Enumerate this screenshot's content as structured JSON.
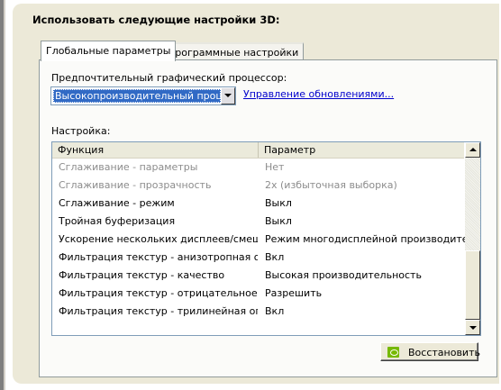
{
  "section_title": "Использовать следующие настройки 3D:",
  "tabs": [
    {
      "label": "Глобальные параметры",
      "active": true
    },
    {
      "label": "Программные настройки",
      "active": false
    }
  ],
  "gpu": {
    "label": "Предпочтительный графический процессор:",
    "selected": "Высокопроизводительный процессо",
    "update_link": "Управление обновлениями..."
  },
  "settings": {
    "label": "Настройка:",
    "columns": [
      "Функция",
      "Параметр"
    ],
    "rows": [
      {
        "feature": "Сглаживание - параметры",
        "value": "Нет",
        "disabled": true
      },
      {
        "feature": "Сглаживание - прозрачность",
        "value": "2x (избыточная выборка)",
        "disabled": true
      },
      {
        "feature": "Сглаживание - режим",
        "value": "Выкл",
        "disabled": false
      },
      {
        "feature": "Тройная буферизация",
        "value": "Выкл",
        "disabled": false
      },
      {
        "feature": "Ускорение нескольких дисплеев/смеша...",
        "value": "Режим многодисплейной производител...",
        "disabled": false
      },
      {
        "feature": "Фильтрация текстур - анизотропная оп...",
        "value": "Вкл",
        "disabled": false
      },
      {
        "feature": "Фильтрация текстур - качество",
        "value": "Высокая производительность",
        "disabled": false
      },
      {
        "feature": "Фильтрация текстур - отрицательное о...",
        "value": "Разрешить",
        "disabled": false
      },
      {
        "feature": "Фильтрация текстур - трилинейная опт...",
        "value": "Вкл",
        "disabled": false
      }
    ]
  },
  "restore_button": {
    "label": "Восстановить",
    "icon": "nvidia-logo-icon"
  },
  "colors": {
    "selection": "#316ac5",
    "link": "#0000cc",
    "nvidia_green": "#76b900"
  }
}
